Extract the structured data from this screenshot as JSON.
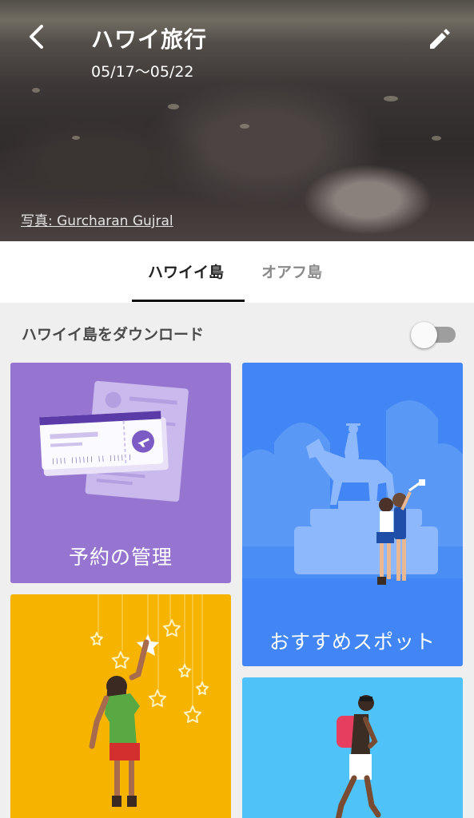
{
  "header": {
    "title": "ハワイ旅行",
    "dates": "05/17〜05/22",
    "photo_credit": "写真: Gurcharan Gujral",
    "back_icon": "chevron-left-icon",
    "edit_icon": "pencil-icon"
  },
  "tabs": [
    {
      "label": "ハワイイ島",
      "active": true
    },
    {
      "label": "オアフ島",
      "active": false
    }
  ],
  "download": {
    "label": "ハワイイ島をダウンロード",
    "enabled": false
  },
  "cards": {
    "reservations": {
      "label": "予約の管理",
      "color": "#9675d0"
    },
    "spots": {
      "label": "おすすめスポット",
      "color": "#4285f4"
    },
    "wishlist": {
      "label": "",
      "color": "#f6b400"
    },
    "explore": {
      "label": "",
      "color": "#4fc3f7"
    }
  },
  "ticket": {
    "barcode_text": "|||| |||||| || |||| |"
  }
}
